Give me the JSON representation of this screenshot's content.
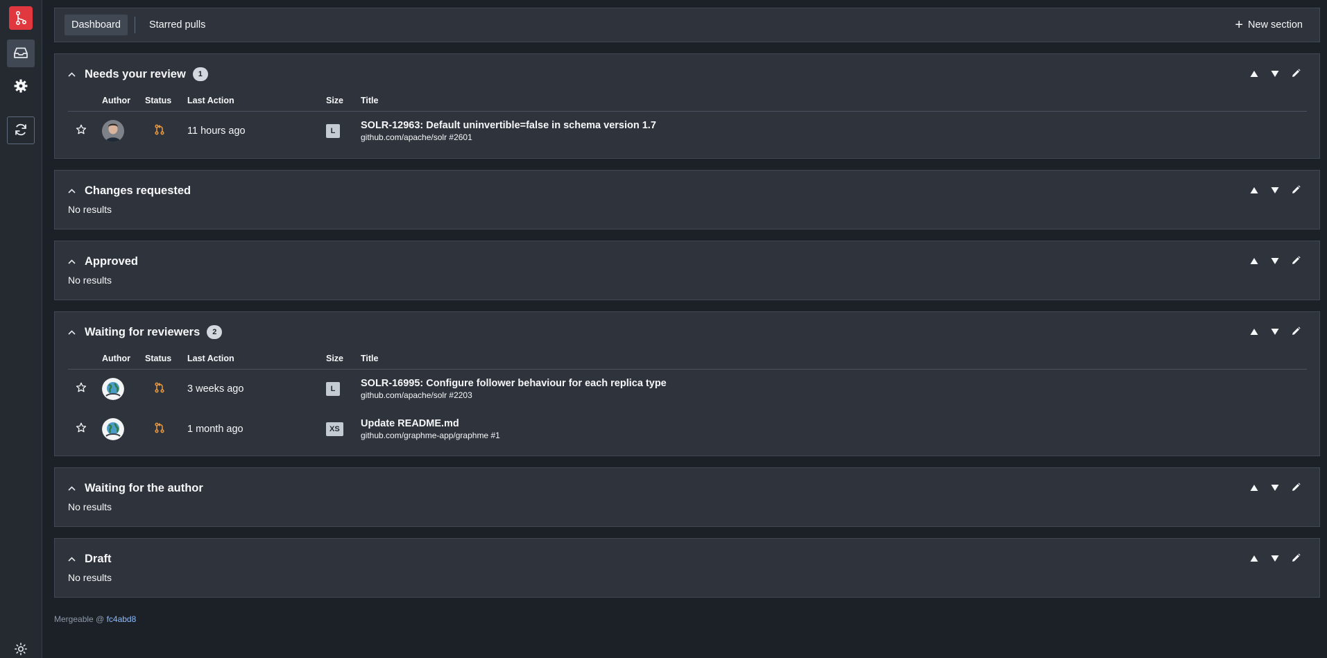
{
  "nav": {
    "tabs": [
      "Dashboard",
      "Starred pulls"
    ],
    "new_section": "New section"
  },
  "columns": {
    "author": "Author",
    "status": "Status",
    "last_action": "Last Action",
    "size": "Size",
    "title": "Title"
  },
  "no_results": "No results",
  "sections": [
    {
      "title": "Needs your review",
      "count": "1",
      "rows": [
        {
          "last_action": "11 hours ago",
          "size": "L",
          "title": "SOLR-12963: Default uninvertible=false in schema version 1.7",
          "repo": "github.com/apache/solr #2601"
        }
      ]
    },
    {
      "title": "Changes requested"
    },
    {
      "title": "Approved"
    },
    {
      "title": "Waiting for reviewers",
      "count": "2",
      "rows": [
        {
          "last_action": "3 weeks ago",
          "size": "L",
          "title": "SOLR-16995: Configure follower behaviour for each replica type",
          "repo": "github.com/apache/solr #2203"
        },
        {
          "last_action": "1 month ago",
          "size": "XS",
          "title": "Update README.md",
          "repo": "github.com/graphme-app/graphme #1"
        }
      ]
    },
    {
      "title": "Waiting for the author"
    },
    {
      "title": "Draft"
    }
  ],
  "footer": {
    "prefix": "Mergeable @ ",
    "commit": "fc4abd8"
  },
  "colors": {
    "accent_red": "#e0383e",
    "status_orange": "#ec9a3c",
    "link_blue": "#8abbff"
  },
  "icons": {
    "logo": "git-branch-icon",
    "inbox": "inbox-icon",
    "settings": "gear-icon",
    "refresh": "refresh-icon",
    "theme": "sun-icon",
    "star": "star-outline-icon",
    "status": "git-pull-request-icon",
    "up": "triangle-up-icon",
    "down": "triangle-down-icon",
    "edit": "pencil-icon"
  }
}
